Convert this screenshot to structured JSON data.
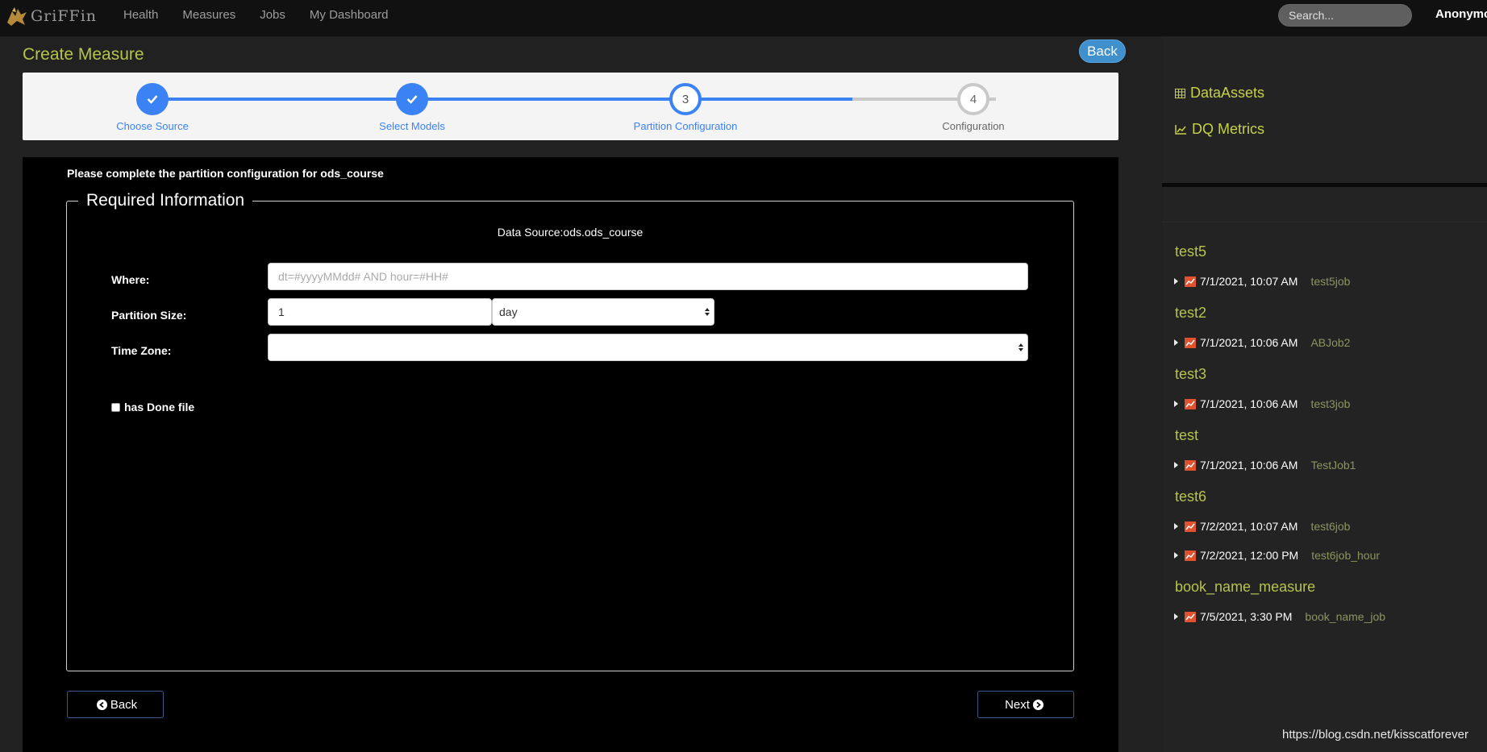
{
  "nav": {
    "logo_text": "GriFFin",
    "links": [
      "Health",
      "Measures",
      "Jobs",
      "My Dashboard"
    ],
    "search_placeholder": "Search...",
    "user": "Anonymou"
  },
  "page": {
    "title": "Create Measure",
    "back_top_label": "Back"
  },
  "steps": [
    {
      "label": "Choose Source",
      "state": "done",
      "number": ""
    },
    {
      "label": "Select Models",
      "state": "done",
      "number": ""
    },
    {
      "label": "Partition Configuration",
      "state": "active",
      "number": "3"
    },
    {
      "label": "Configuration",
      "state": "pending",
      "number": "4"
    }
  ],
  "form": {
    "instruction": "Please complete the partition configuration for ods_course",
    "legend": "Required Information",
    "data_source": "Data Source:ods.ods_course",
    "where_label": "Where:",
    "where_placeholder": "dt=#yyyyMMdd# AND hour=#HH#",
    "partition_size_label": "Partition Size:",
    "partition_size_value": "1",
    "partition_unit": "day",
    "timezone_label": "Time Zone:",
    "timezone_value": "",
    "done_file_label": "has Done file",
    "done_file_checked": false,
    "back_label": "Back",
    "next_label": "Next"
  },
  "sidebar": {
    "links": [
      "DataAssets",
      "DQ Metrics"
    ],
    "measures": [
      {
        "name": "test5",
        "jobs": [
          {
            "date": "7/1/2021, 10:07 AM",
            "job": "test5job"
          }
        ]
      },
      {
        "name": "test2",
        "jobs": [
          {
            "date": "7/1/2021, 10:06 AM",
            "job": "ABJob2"
          }
        ]
      },
      {
        "name": "test3",
        "jobs": [
          {
            "date": "7/1/2021, 10:06 AM",
            "job": "test3job"
          }
        ]
      },
      {
        "name": "test",
        "jobs": [
          {
            "date": "7/1/2021, 10:06 AM",
            "job": "TestJob1"
          }
        ]
      },
      {
        "name": "test6",
        "jobs": [
          {
            "date": "7/2/2021, 10:07 AM",
            "job": "test6job"
          },
          {
            "date": "7/2/2021, 12:00 PM",
            "job": "test6job_hour"
          }
        ]
      },
      {
        "name": "book_name_measure",
        "jobs": [
          {
            "date": "7/5/2021, 3:30 PM",
            "job": "book_name_job"
          }
        ]
      }
    ]
  },
  "watermark": "https://blog.csdn.net/kisscatforever",
  "colors": {
    "accent_blue": "#3b82f4",
    "olive": "#b6c44a",
    "chart_icon": "#e0512d"
  }
}
